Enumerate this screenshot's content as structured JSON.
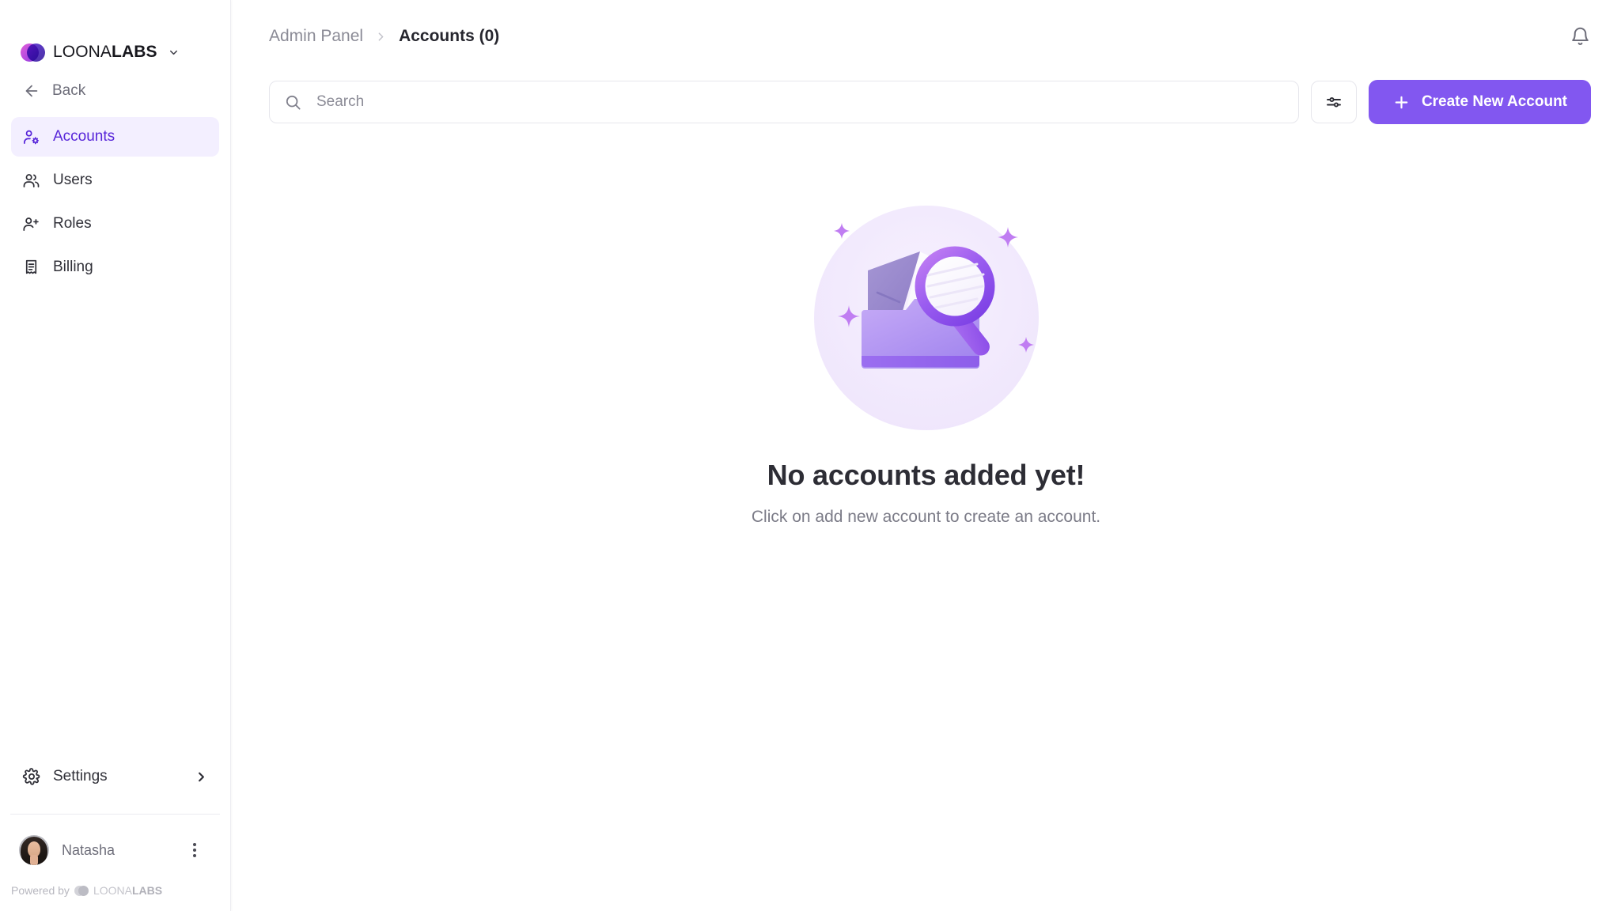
{
  "brand": {
    "name_thin": "LOONA",
    "name_bold": "LABS",
    "chevron_icon": "chevron-down-icon"
  },
  "sidebar": {
    "back_label": "Back",
    "back_icon": "arrow-left-icon",
    "items": [
      {
        "label": "Accounts",
        "icon": "user-cog-icon",
        "active": true
      },
      {
        "label": "Users",
        "icon": "users-icon",
        "active": false
      },
      {
        "label": "Roles",
        "icon": "user-plus-icon",
        "active": false
      },
      {
        "label": "Billing",
        "icon": "receipt-icon",
        "active": false
      }
    ],
    "settings": {
      "label": "Settings",
      "icon": "gear-icon",
      "chevron_icon": "chevron-right-icon"
    },
    "user": {
      "name": "Natasha",
      "avatar_icon": "avatar",
      "menu_icon": "kebab-menu-icon"
    },
    "powered": {
      "prefix": "Powered by",
      "name_thin": "LOONA",
      "name_bold": "LABS"
    }
  },
  "header": {
    "breadcrumb_root": "Admin Panel",
    "breadcrumb_separator_icon": "chevron-right-icon",
    "breadcrumb_current": "Accounts (0)",
    "bell_icon": "bell-icon"
  },
  "toolbar": {
    "search_placeholder": "Search",
    "search_value": "",
    "search_icon": "search-icon",
    "filter_icon": "sliders-icon",
    "create_label": "Create New Account",
    "create_icon": "plus-icon"
  },
  "empty_state": {
    "illustration_icon": "empty-folder-search-illustration",
    "title": "No accounts added yet!",
    "subtitle": "Click on add new account to create an account."
  },
  "colors": {
    "accent": "#8257f0",
    "accent_active_text": "#5725d9",
    "accent_active_bg": "#f3efff",
    "text_primary": "#26262e",
    "text_muted": "#8b8b96",
    "border": "#e6e6ec"
  }
}
